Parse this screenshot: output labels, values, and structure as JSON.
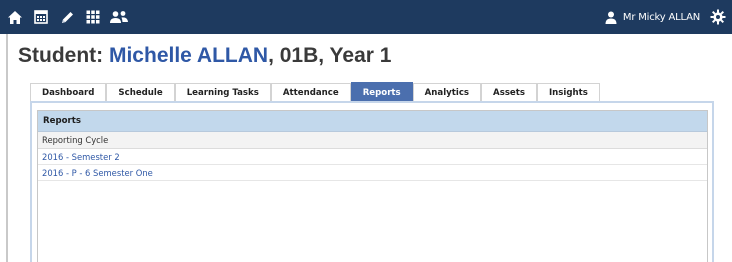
{
  "topbar": {
    "nav_icons": [
      "home-icon",
      "calendar-icon",
      "pencil-icon",
      "grid-icon",
      "users-icon"
    ],
    "user_name": "Mr Micky ALLAN",
    "background": "#1e3a5f"
  },
  "page": {
    "title_prefix": "Student: ",
    "student_name": "Michelle ALLAN",
    "title_suffix": ", 01B, Year 1"
  },
  "tabs": [
    {
      "label": "Dashboard"
    },
    {
      "label": "Schedule"
    },
    {
      "label": "Learning Tasks"
    },
    {
      "label": "Attendance"
    },
    {
      "label": "Reports"
    },
    {
      "label": "Analytics"
    },
    {
      "label": "Assets"
    },
    {
      "label": "Insights"
    }
  ],
  "active_tab": "Reports",
  "reports": {
    "panel_title": "Reports",
    "column_header": "Reporting Cycle",
    "rows": [
      "2016 - Semester 2",
      "2016 - P - 6 Semester One"
    ]
  },
  "colors": {
    "accent": "#4b6fae",
    "link": "#2f58a6",
    "panel_header": "#c2d8ec"
  }
}
